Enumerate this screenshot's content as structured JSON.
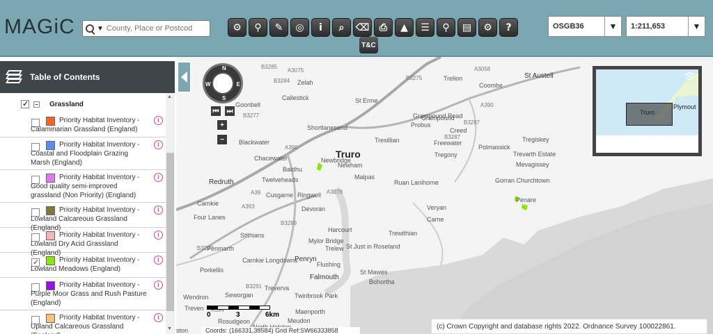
{
  "app": {
    "logo": "MAGiC"
  },
  "search": {
    "placeholder": "County, Place or Postcod"
  },
  "toolbar": {
    "tc_label": "T&C"
  },
  "projection": {
    "value": "OSGB36"
  },
  "scale": {
    "value": "1:211,653"
  },
  "toc": {
    "title": "Table of Contents",
    "group": "Grassland",
    "layers": [
      {
        "label": "Priority Habitat Inventory - Calaminarian Grassland (England)",
        "color": "#f26522",
        "checked": false
      },
      {
        "label": "Priority Habitat Inventory - Coastal and Floodplain Grazing Marsh (England)",
        "color": "#5b8ef0",
        "checked": false
      },
      {
        "label": "Priority Habitat Inventory - Good quality semi-improved grassland (Non Priority) (England)",
        "color": "#e37af5",
        "checked": false
      },
      {
        "label": "Priority Habitat Inventory - Lowland Calcareous Grassland (England)",
        "color": "#7b7a3c",
        "checked": false
      },
      {
        "label": "Priority Habitat Inventory - Lowland Dry Acid Grassland (England)",
        "color": "#f7b5b5",
        "checked": false
      },
      {
        "label": "Priority Habitat Inventory - Lowland Meadows (England)",
        "color": "#8be60c",
        "checked": true
      },
      {
        "label": "Priority Habitat Inventory - Purple Moor Grass and Rush Pasture (England)",
        "color": "#9c10e8",
        "checked": false
      },
      {
        "label": "Priority Habitat Inventory - Upland Calcareous Grassland (England)",
        "color": "#f5c27a",
        "checked": false
      }
    ]
  },
  "map": {
    "compass": {
      "n": "N",
      "s": "S",
      "e": "E",
      "w": "W"
    },
    "places": {
      "truro": "Truro",
      "redruth": "Redruth",
      "falmouth": "Falmouth",
      "penryn": "Penryn",
      "st_austell": "St Austell",
      "zelah": "Zelah",
      "callestick": "Callestick",
      "goonbell": "Goonbell",
      "st_erme": "St Erme",
      "trelion": "Trelion",
      "coombe": "Coombe",
      "grampound": "Grampound",
      "probus": "Probus",
      "creed": "Creed",
      "grampound_road": "Grampound Road",
      "shortlanesend": "Shortlanesend",
      "tresillian": "Tresillian",
      "blackwater": "Blackwater",
      "chacewater": "Chacewater",
      "newbridge": "Newbridge",
      "newham": "Newham",
      "baldhu": "Baldhu",
      "twelveheads": "Twelveheads",
      "malpas": "Malpas",
      "freewater": "Freewater",
      "tregony": "Tregony",
      "polmassick": "Polmassick",
      "tregiskey": "Tregiskey",
      "trevarth_estate": "Trevarth Estate",
      "mevagissey": "Mevagissey",
      "gorran_churchtown": "Gorran Churchtown",
      "penare": "Penare",
      "ruan_lanihorne": "Ruan Lanihorne",
      "cusgarne": "Cusgarne",
      "ringwell": "Ringwell",
      "carnkie": "Carnkie",
      "four_lanes": "Four Lanes",
      "devoran": "Devoran",
      "veryan": "Veryan",
      "carne": "Carne",
      "harcourt": "Harcourt",
      "trewithian": "Trewithian",
      "stithians": "Stithians",
      "mylor_bridge": "Mylor Bridge",
      "trelew": "Trelew",
      "st_just": "St Just in Roseland",
      "penmarth": "Penmarth",
      "carnkie_longdowns": "Carnkie Longdowns",
      "porkellis": "Porkellis",
      "flushing": "Flushing",
      "st_mawes": "St Mawes",
      "bohortha": "Bohortha",
      "seworgan": "Seworgan",
      "treverva": "Treverva",
      "wendron": "Wendron",
      "twinbrook_park": "Twinbrook Park",
      "treven": "Treven",
      "maenporth": "Maenporth",
      "meudon": "Meudon",
      "rosudgeon": "Rosudgeon",
      "north_helston": "North Helston",
      "ston": "ston"
    },
    "roads": {
      "b3285": "B3285",
      "a3075": "A3075",
      "b3284": "B3284",
      "b3277": "B3277",
      "a390": "A390",
      "a3058": "A3058",
      "b3275": "B3275",
      "a3078": "A3078",
      "b3287": "B3287",
      "b3287b": "B3287",
      "a39": "A39",
      "a393": "A393",
      "b3289": "B3289",
      "b3297": "B3297",
      "a394": "A394",
      "b3291": "B3291"
    },
    "overview": {
      "truro": "Truro",
      "plymouth": "Plymout"
    },
    "scalebar": {
      "l0": "0",
      "l1": "3",
      "l2": "6km"
    },
    "coords": "Coords: (166331,38584) Grid Ref:SW66333858",
    "copyright": "(c) Crown Copyright and database rights 2022. Ordnance Survey 100022861."
  }
}
